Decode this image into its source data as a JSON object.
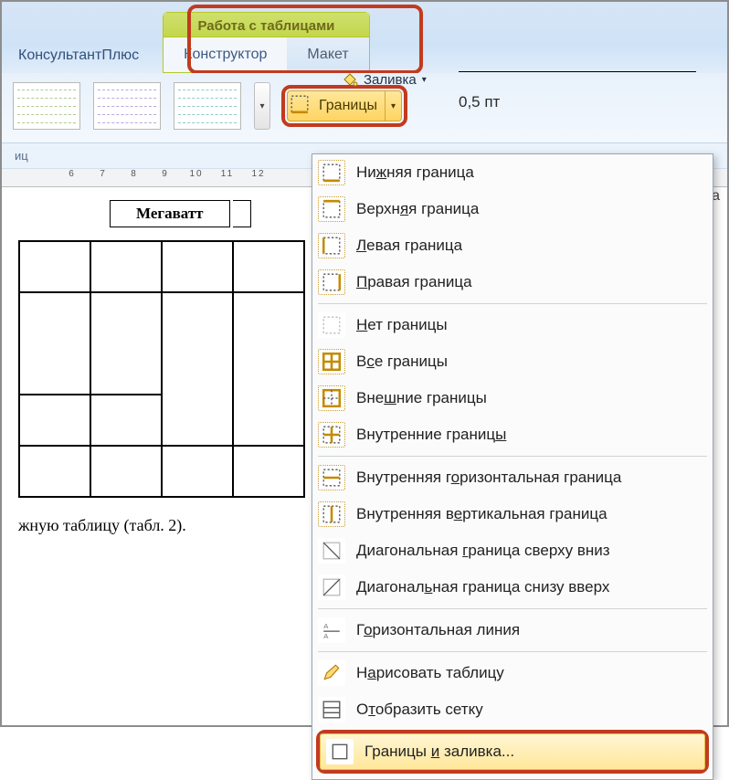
{
  "tabs": {
    "main": "КонсультантПлюс",
    "tools_title": "Работа с таблицами",
    "constructor": "Конструктор",
    "layout": "Макет"
  },
  "ribbon": {
    "fill_label": "Заливка",
    "borders_label": "Границы",
    "pt_label": "0,5 пт",
    "group_label": "иц"
  },
  "ruler": [
    "6",
    "7",
    "8",
    "9",
    "10",
    "11",
    "12"
  ],
  "doc": {
    "header_cell": "Мегаватт",
    "text_fragment": "жную таблицу (табл. 2)."
  },
  "menu": {
    "items": [
      {
        "id": "b-bottom",
        "label_pre": "Ни",
        "u": "ж",
        "label_post": "няя граница"
      },
      {
        "id": "b-top",
        "label_pre": "Верхн",
        "u": "я",
        "label_post": "я граница"
      },
      {
        "id": "b-left",
        "label_pre": "",
        "u": "Л",
        "label_post": "евая граница"
      },
      {
        "id": "b-right",
        "label_pre": "",
        "u": "П",
        "label_post": "равая граница"
      }
    ],
    "items2": [
      {
        "id": "b-none",
        "label_pre": "",
        "u": "Н",
        "label_post": "ет границы"
      },
      {
        "id": "b-all",
        "label_pre": "В",
        "u": "с",
        "label_post": "е границы"
      },
      {
        "id": "b-outer",
        "label_pre": "Вне",
        "u": "ш",
        "label_post": "ние границы"
      },
      {
        "id": "b-inner",
        "label_pre": "Внутренние границ",
        "u": "ы",
        "label_post": ""
      }
    ],
    "items3": [
      {
        "id": "b-hinner",
        "label_pre": "Внутренняя г",
        "u": "о",
        "label_post": "ризонтальная граница"
      },
      {
        "id": "b-vinner",
        "label_pre": "Внутренняя в",
        "u": "е",
        "label_post": "ртикальная граница"
      },
      {
        "id": "b-diag-d",
        "label_pre": "Диагональная ",
        "u": "г",
        "label_post": "раница сверху вниз"
      },
      {
        "id": "b-diag-u",
        "label_pre": "Диагонал",
        "u": "ь",
        "label_post": "ная граница снизу вверх"
      }
    ],
    "items4": [
      {
        "id": "hline",
        "label_pre": "Г",
        "u": "о",
        "label_post": "ризонтальная линия"
      }
    ],
    "items5": [
      {
        "id": "draw",
        "label_pre": "Н",
        "u": "а",
        "label_post": "рисовать таблицу"
      },
      {
        "id": "grid",
        "label_pre": "О",
        "u": "т",
        "label_post": "образить сетку"
      }
    ],
    "dialog": {
      "label_pre": "Границы ",
      "u": "и",
      "label_post": " заливка..."
    }
  },
  "anchor_char": "а"
}
